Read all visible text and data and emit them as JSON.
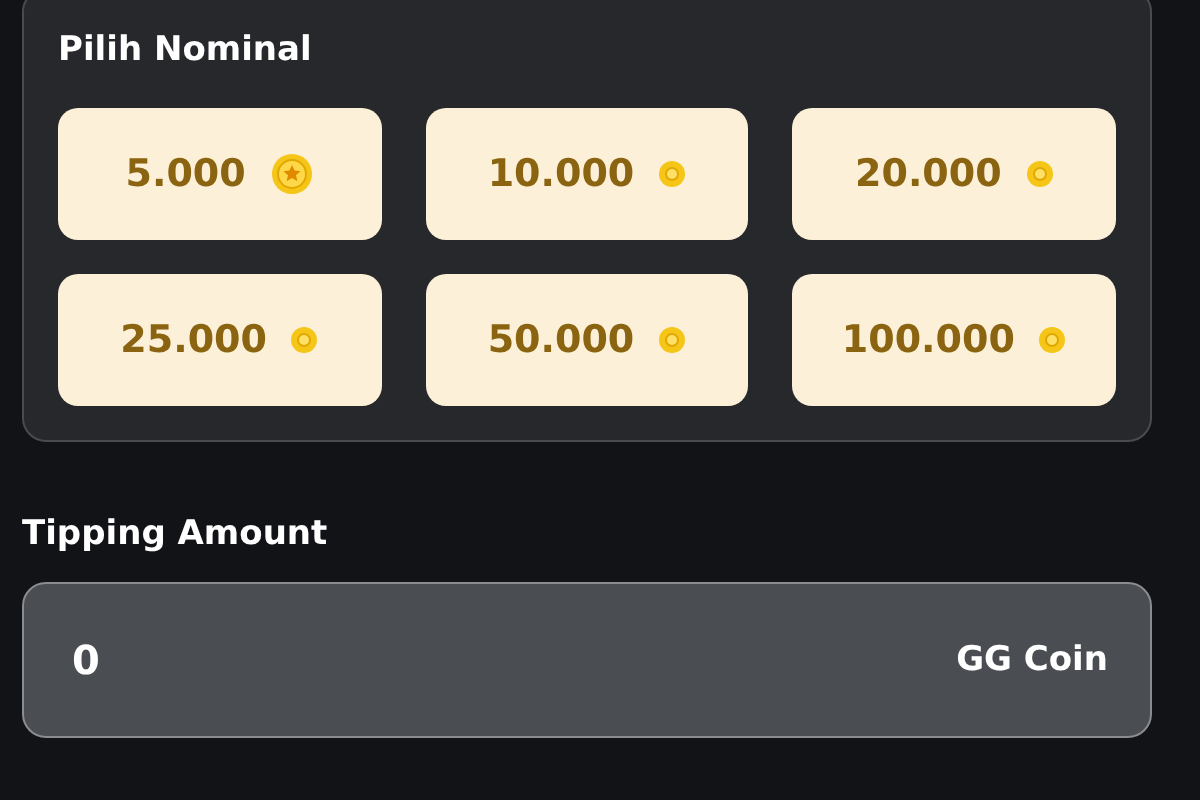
{
  "nominal_panel": {
    "title": "Pilih Nominal",
    "options": [
      {
        "amount": "5.000",
        "kind": "star-coin"
      },
      {
        "amount": "10.000",
        "kind": "coin"
      },
      {
        "amount": "20.000",
        "kind": "coin"
      },
      {
        "amount": "25.000",
        "kind": "coin"
      },
      {
        "amount": "50.000",
        "kind": "coin"
      },
      {
        "amount": "100.000",
        "kind": "coin"
      }
    ]
  },
  "tipping": {
    "label": "Tipping Amount",
    "value": "0",
    "unit": "GG Coin"
  }
}
